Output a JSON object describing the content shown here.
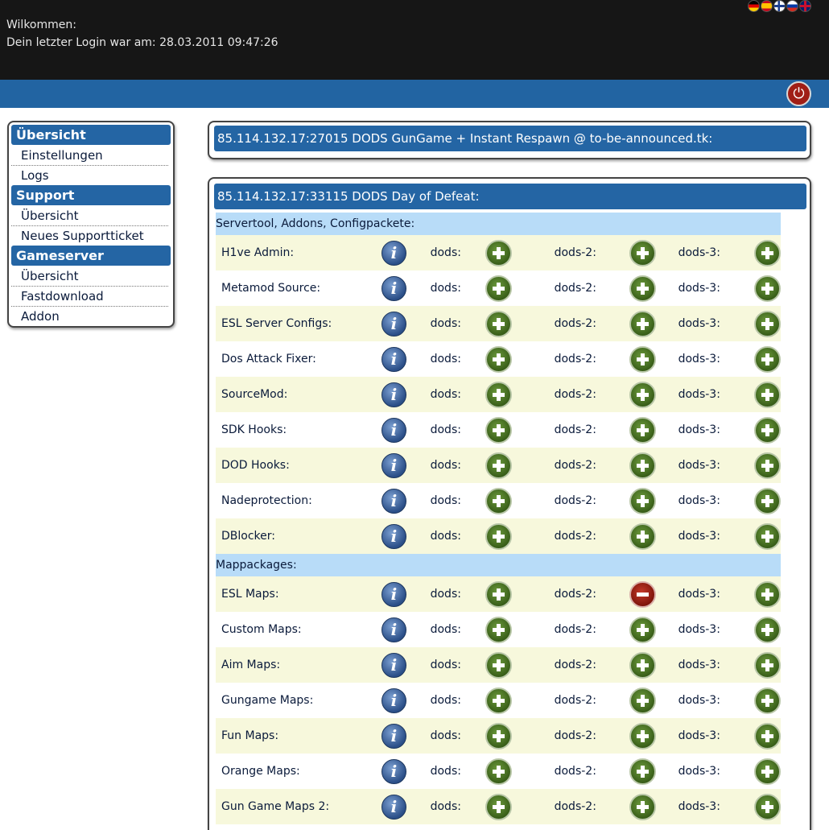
{
  "header": {
    "welcome": "Wilkommen:",
    "last_login": "Dein letzter Login war am: 28.03.2011 09:47:26",
    "flags": [
      "german-flag-icon",
      "spanish-flag-icon",
      "finnish-flag-icon",
      "russian-flag-icon",
      "uk-flag-icon"
    ]
  },
  "nav": {
    "logout_icon": "power-icon"
  },
  "sidebar": [
    {
      "title": "Übersicht",
      "items": [
        "Einstellungen",
        "Logs"
      ]
    },
    {
      "title": "Support",
      "items": [
        "Übersicht",
        "Neues Supportticket"
      ]
    },
    {
      "title": "Gameserver",
      "items": [
        "Übersicht",
        "Fastdownload",
        "Addon"
      ]
    }
  ],
  "panel1": {
    "title": "85.114.132.17:27015 DODS GunGame + Instant Respawn @ to-be-announced.tk:"
  },
  "panel2": {
    "title": "85.114.132.17:33115 DODS Day of Defeat:",
    "columns": [
      "dods:",
      "dods-2:",
      "dods-3:"
    ],
    "sections": [
      {
        "title": "Servertool, Addons, Configpackete:",
        "rows": [
          {
            "name": "H1ve Admin:",
            "status": [
              "add",
              "add",
              "add"
            ]
          },
          {
            "name": "Metamod Source:",
            "status": [
              "add",
              "add",
              "add"
            ]
          },
          {
            "name": "ESL Server Configs:",
            "status": [
              "add",
              "add",
              "add"
            ]
          },
          {
            "name": "Dos Attack Fixer:",
            "status": [
              "add",
              "add",
              "add"
            ]
          },
          {
            "name": "SourceMod:",
            "status": [
              "add",
              "add",
              "add"
            ]
          },
          {
            "name": "SDK Hooks:",
            "status": [
              "add",
              "add",
              "add"
            ]
          },
          {
            "name": "DOD Hooks:",
            "status": [
              "add",
              "add",
              "add"
            ]
          },
          {
            "name": "Nadeprotection:",
            "status": [
              "add",
              "add",
              "add"
            ]
          },
          {
            "name": "DBlocker:",
            "status": [
              "add",
              "add",
              "add"
            ]
          }
        ]
      },
      {
        "title": "Mappackages:",
        "rows": [
          {
            "name": "ESL Maps:",
            "status": [
              "add",
              "remove",
              "add"
            ]
          },
          {
            "name": "Custom Maps:",
            "status": [
              "add",
              "add",
              "add"
            ]
          },
          {
            "name": "Aim Maps:",
            "status": [
              "add",
              "add",
              "add"
            ]
          },
          {
            "name": "Gungame Maps:",
            "status": [
              "add",
              "add",
              "add"
            ]
          },
          {
            "name": "Fun Maps:",
            "status": [
              "add",
              "add",
              "add"
            ]
          },
          {
            "name": "Orange Maps:",
            "status": [
              "add",
              "add",
              "add"
            ]
          },
          {
            "name": "Gun Game Maps 2:",
            "status": [
              "add",
              "add",
              "add"
            ]
          }
        ]
      }
    ]
  }
}
